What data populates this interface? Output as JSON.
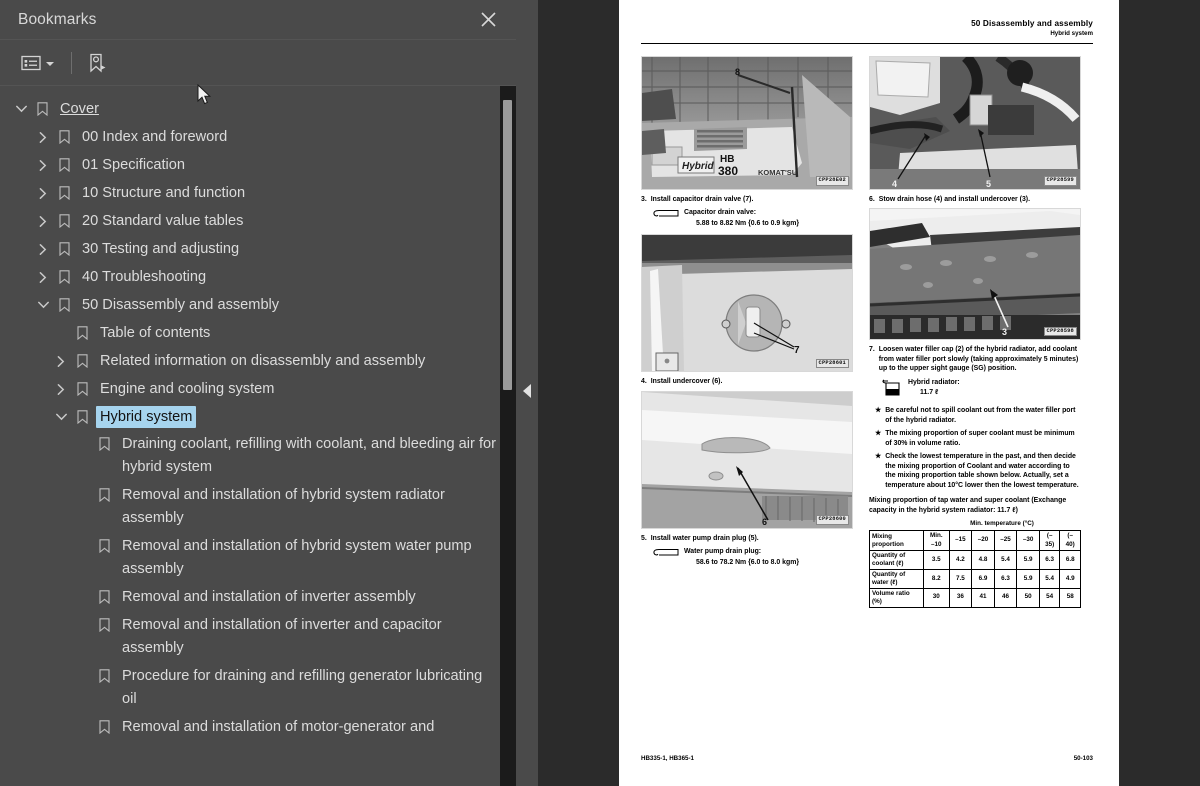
{
  "panel": {
    "title": "Bookmarks",
    "close_icon": "close-icon",
    "toolbar": {
      "list_options_icon": "list-options-icon",
      "dropdown_caret_icon": "chevron-down-icon",
      "new_bookmark_icon": "new-bookmark-icon"
    }
  },
  "bookmarks": [
    {
      "label": "Cover",
      "level": 0,
      "state": "expanded",
      "selected": false
    },
    {
      "label": "00 Index and foreword",
      "level": 1,
      "state": "collapsed",
      "selected": false
    },
    {
      "label": "01 Specification",
      "level": 1,
      "state": "collapsed",
      "selected": false
    },
    {
      "label": "10 Structure and function",
      "level": 1,
      "state": "collapsed",
      "selected": false
    },
    {
      "label": "20 Standard value tables",
      "level": 1,
      "state": "collapsed",
      "selected": false
    },
    {
      "label": "30 Testing and adjusting",
      "level": 1,
      "state": "collapsed",
      "selected": false
    },
    {
      "label": "40 Troubleshooting",
      "level": 1,
      "state": "collapsed",
      "selected": false
    },
    {
      "label": "50 Disassembly and assembly",
      "level": 1,
      "state": "expanded",
      "selected": false
    },
    {
      "label": "Table of contents",
      "level": 2,
      "state": "leaf",
      "selected": false
    },
    {
      "label": "Related information on disassembly and assembly",
      "level": 2,
      "state": "collapsed",
      "selected": false
    },
    {
      "label": "Engine and cooling system",
      "level": 2,
      "state": "collapsed",
      "selected": false
    },
    {
      "label": "Hybrid system",
      "level": 2,
      "state": "expanded",
      "selected": true
    },
    {
      "label": "Draining coolant, refilling with coolant, and bleeding air for hybrid system",
      "level": 3,
      "state": "leaf",
      "selected": false
    },
    {
      "label": "Removal and installation of hybrid system radiator assembly",
      "level": 3,
      "state": "leaf",
      "selected": false
    },
    {
      "label": "Removal and installation of hybrid system water pump assembly",
      "level": 3,
      "state": "leaf",
      "selected": false
    },
    {
      "label": "Removal and installation of inverter assembly",
      "level": 3,
      "state": "leaf",
      "selected": false
    },
    {
      "label": "Removal and installation of inverter and capacitor assembly",
      "level": 3,
      "state": "leaf",
      "selected": false
    },
    {
      "label": "Procedure for draining and refilling generator lubricating oil",
      "level": 3,
      "state": "leaf",
      "selected": false
    },
    {
      "label": "Removal and installation of motor-generator and",
      "level": 3,
      "state": "leaf",
      "selected": false
    }
  ],
  "splitter": {
    "collapse_icon": "collapse-left-arrow-icon"
  },
  "document": {
    "header": {
      "section": "50 Disassembly and assembly",
      "subsection": "Hybrid system"
    },
    "left_column": {
      "photo1": {
        "id": "CPP28E02",
        "alt": "Komatsu HB 380 Hybrid excavator in workshop",
        "callouts": [
          "8"
        ]
      },
      "step3": {
        "num": "3.",
        "text": "Install capacitor drain valve (7)."
      },
      "spec3": {
        "label": "Capacitor drain valve:",
        "value": "5.88 to 8.82 Nm {0.6 to 0.9 kgm}"
      },
      "photo2": {
        "id": "CPP28601",
        "alt": "Undercover drain plug detail",
        "callouts": [
          "7"
        ]
      },
      "step4": {
        "num": "4.",
        "text": "Install undercover (6)."
      },
      "photo3": {
        "id": "CPP28600",
        "alt": "Underside of machine showing undercover",
        "callouts": [
          "6"
        ]
      },
      "step5": {
        "num": "5.",
        "text": "Install water pump drain plug (5)."
      },
      "spec5": {
        "label": "Water pump drain plug:",
        "value": "58.6 to 78.2 Nm {6.0 to 8.0 kgm}"
      }
    },
    "right_column": {
      "photo4": {
        "id": "CPP28599",
        "alt": "Engine bay with drain hose and water pump",
        "callouts": [
          "4",
          "5"
        ]
      },
      "step6": {
        "num": "6.",
        "text": "Stow drain hose (4) and install undercover (3)."
      },
      "photo5": {
        "id": "CPP28598",
        "alt": "Undercarriage view of undercover",
        "callouts": [
          "3"
        ]
      },
      "step7": {
        "num": "7.",
        "text": "Loosen water filler cap (2) of the hybrid radiator, add coolant from water filler port slowly (taking approximately 5 minutes) up to the upper sight gauge (SG) position."
      },
      "spec7": {
        "label": "Hybrid radiator:",
        "value": "11.7 ℓ"
      },
      "bullets": [
        "Be careful not to spill coolant out from the water filler port of the hybrid radiator.",
        "The mixing proportion of super coolant must be minimum of 30% in volume ratio.",
        "Check the lowest temperature in the past, and then decide the mixing proportion of Coolant and water according to the mixing proportion table shown below. Actually, set a temperature about 10°C lower then the lowest temperature."
      ],
      "table_intro": "Mixing proportion of tap water and super coolant (Exchange capacity in the hybrid system radiator: 11.7 ℓ)"
    },
    "footer": {
      "model": "HB335-1, HB365-1",
      "page": "50-103"
    }
  },
  "chart_data": {
    "type": "table",
    "title": "Mixing proportion of tap water and super coolant",
    "supertitle": "Min. temperature (°C)",
    "row_header_label": "Mixing proportion",
    "categories": [
      "Min. –10",
      "–15",
      "–20",
      "–25",
      "–30",
      "(– 35)",
      "(– 40)"
    ],
    "series": [
      {
        "name": "Quantity of coolant (ℓ)",
        "values": [
          "3.5",
          "4.2",
          "4.8",
          "5.4",
          "5.9",
          "6.3",
          "6.8"
        ]
      },
      {
        "name": "Quantity of water (ℓ)",
        "values": [
          "8.2",
          "7.5",
          "6.9",
          "6.3",
          "5.9",
          "5.4",
          "4.9"
        ]
      },
      {
        "name": "Volume ratio (%)",
        "values": [
          "30",
          "36",
          "41",
          "46",
          "50",
          "54",
          "58"
        ]
      }
    ]
  }
}
